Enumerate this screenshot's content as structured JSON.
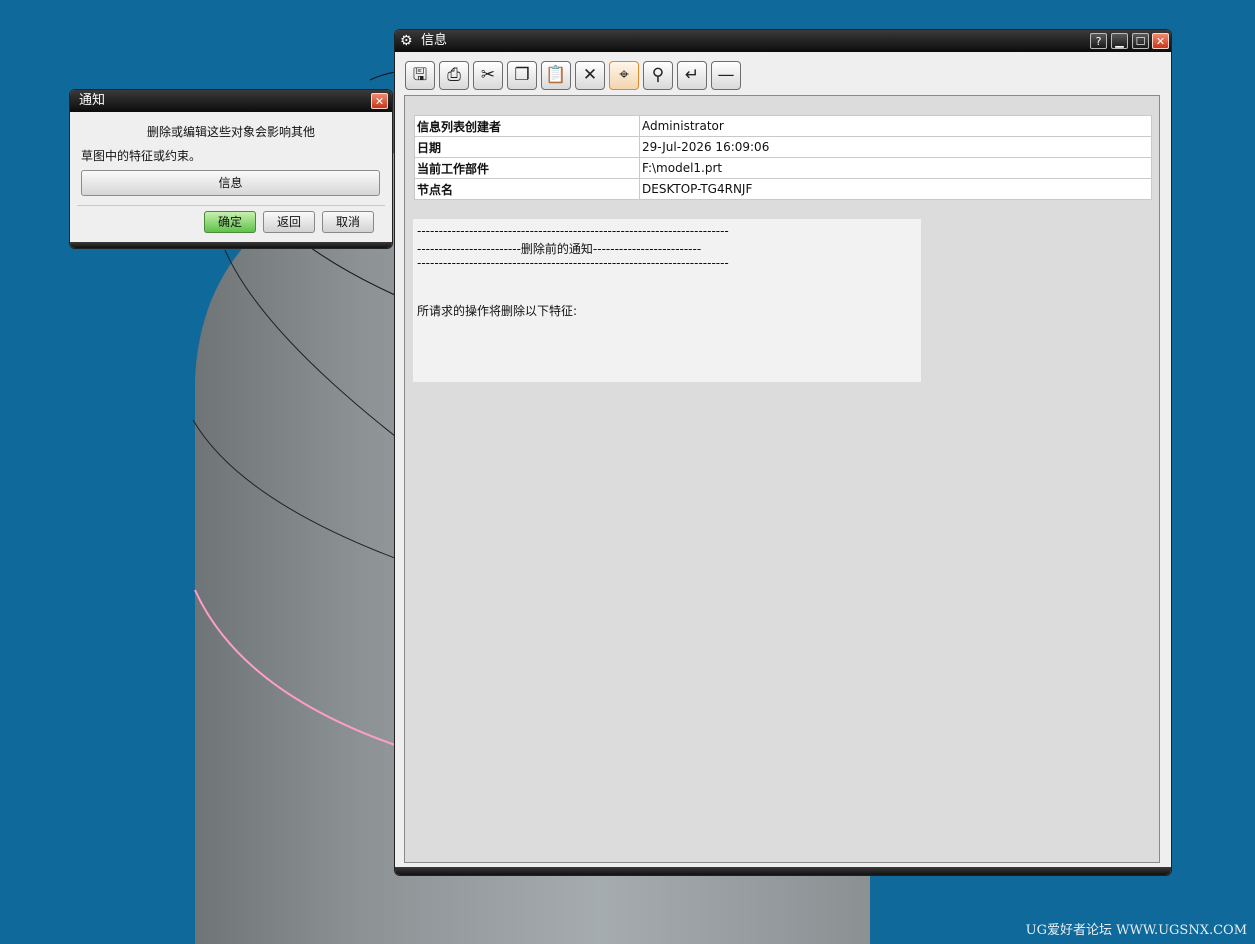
{
  "colors": {
    "desktop": "#0f6a9b",
    "title_bar": "#111111",
    "ok_button": "#5fc24a",
    "active_tool": "#e08a2c"
  },
  "notify": {
    "title": "通知",
    "message_line1": "删除或编辑这些对象会影响其他",
    "message_line2": "草图中的特征或约束。",
    "info_button": "信息",
    "ok": "确定",
    "back": "返回",
    "cancel": "取消"
  },
  "infowin": {
    "title": "信息",
    "help_btn": "?",
    "toolbar": [
      {
        "name": "save-icon",
        "glyph": "🖫"
      },
      {
        "name": "print-icon",
        "glyph": "⎙"
      },
      {
        "name": "cut-icon",
        "glyph": "✂"
      },
      {
        "name": "copy-icon",
        "glyph": "❐"
      },
      {
        "name": "paste-icon",
        "glyph": "📋"
      },
      {
        "name": "delete-icon",
        "glyph": "✕"
      },
      {
        "name": "locate-icon",
        "glyph": "⌖"
      },
      {
        "name": "find-icon",
        "glyph": "⚲"
      },
      {
        "name": "wrap-icon",
        "glyph": "↵"
      },
      {
        "name": "separator-icon",
        "glyph": "—"
      }
    ],
    "props": [
      {
        "key": "信息列表创建者",
        "value": "Administrator"
      },
      {
        "key": "日期",
        "value": "29-Jul-2026 16:09:06"
      },
      {
        "key": "当前工作部件",
        "value": "F:\\model1.prt"
      },
      {
        "key": "节点名",
        "value": "DESKTOP-TG4RNJF"
      }
    ],
    "dash_line": "------------------------------------------------------------------------",
    "heading_line": "------------------------删除前的通知-------------------------",
    "body_text": "所请求的操作将删除以下特征:"
  },
  "watermark": "UG爱好者论坛 WWW.UGSNX.COM"
}
